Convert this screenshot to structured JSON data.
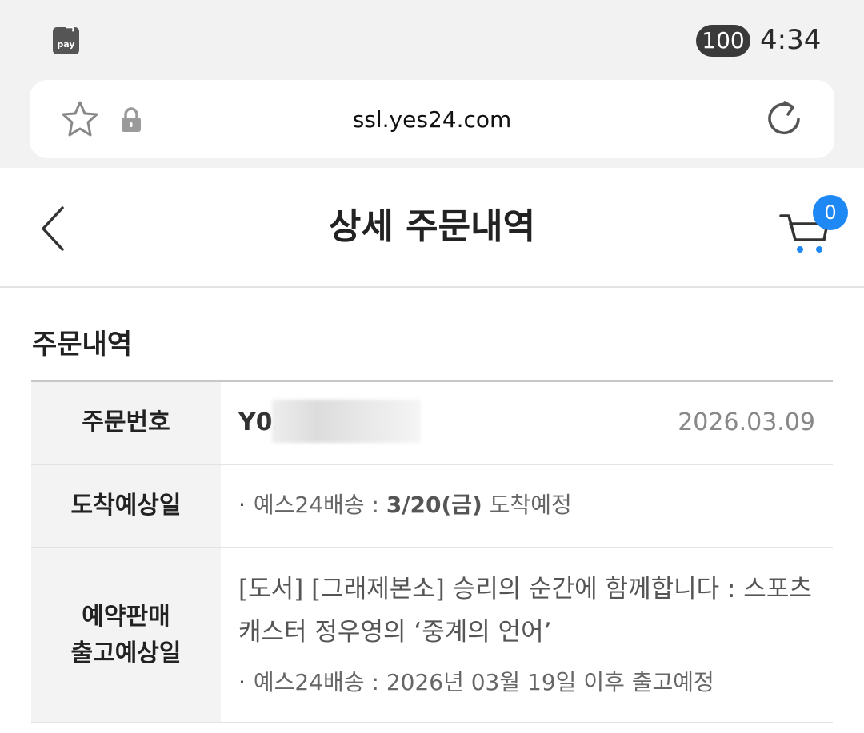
{
  "status_bar": {
    "pay_label": "pay",
    "battery": "100",
    "time": "4:34"
  },
  "browser": {
    "url": "ssl.yes24.com"
  },
  "header": {
    "title": "상세 주문내역",
    "cart_count": "0"
  },
  "section": {
    "title": "주문내역"
  },
  "order": {
    "number_label": "주문번호",
    "number_visible": "Y03",
    "date": "2026.03.09",
    "arrival_label": "도착예상일",
    "arrival_method": "예스24배송 :",
    "arrival_date": "3/20(금)",
    "arrival_suffix": "도착예정",
    "preorder_label_line1": "예약판매",
    "preorder_label_line2": "출고예상일",
    "book_title": "[도서] [그래제본소] 승리의 순간에 함께합니다 : 스포츠 캐스터 정우영의 ‘중계의 언어’",
    "ship_method": "예스24배송 :",
    "ship_text": "2026년 03월 19일 이후 출고예정"
  },
  "colors": {
    "accent_blue": "#1e88f5",
    "header_bg": "#f2f2f2",
    "table_head_bg": "#f3f3f3"
  },
  "icons": [
    "pay-icon",
    "star-icon",
    "lock-icon",
    "reload-icon",
    "back-icon",
    "cart-icon"
  ]
}
